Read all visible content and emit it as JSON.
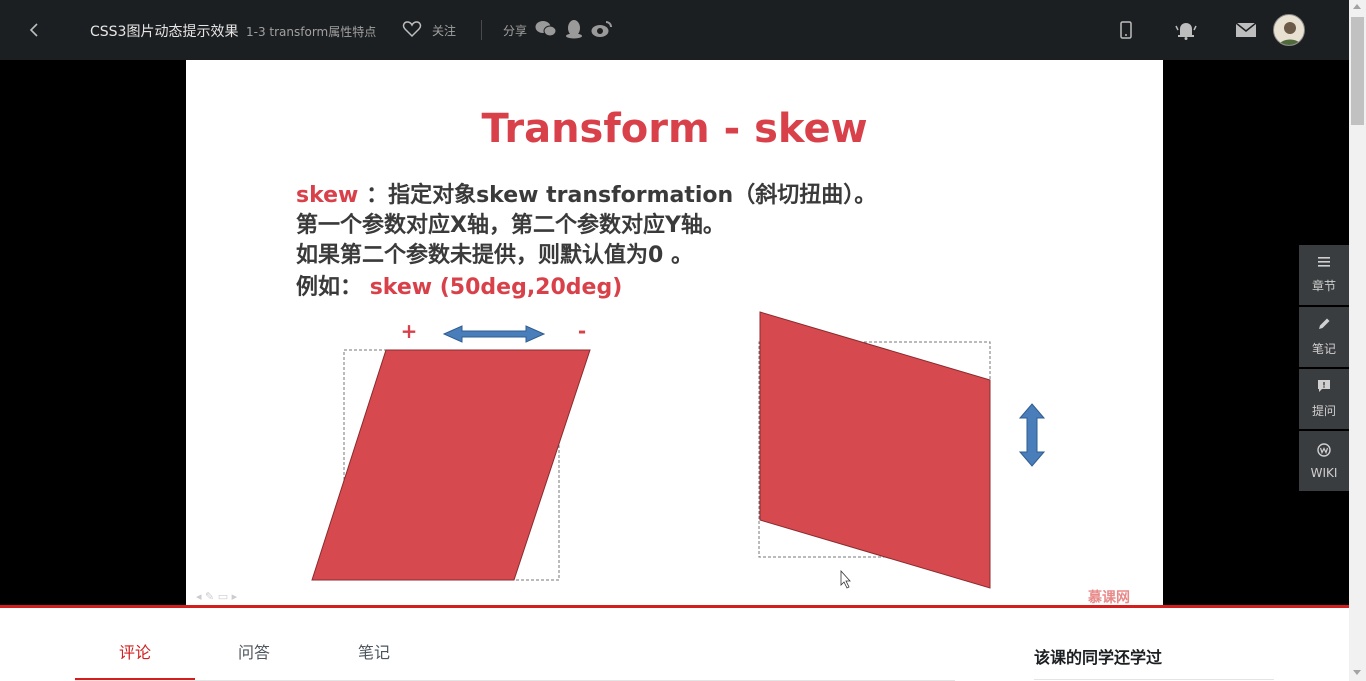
{
  "topbar": {
    "course_title": "CSS3图片动态提示效果",
    "chapter_title": "1-3 transform属性特点",
    "follow_label": "关注",
    "share_label": "分享",
    "icons": [
      "back-icon",
      "heart-icon",
      "wechat-icon",
      "qq-icon",
      "weibo-icon",
      "mobile-icon",
      "bell-icon",
      "mail-icon",
      "avatar"
    ]
  },
  "slide": {
    "title": "Transform - skew",
    "line1_keyword": "skew",
    "line1_text": "：指定对象skew transformation（斜切扭曲）。",
    "line2": "第一个参数对应X轴，第二个参数对应Y轴。",
    "line3": "如果第二个参数未提供，则默认值为0 。",
    "example_label": "例如：",
    "example_value": "skew (50deg,20deg)",
    "plus_sign": "+",
    "minus_sign": "-",
    "logo": "慕课网",
    "colors": {
      "accent": "#d9414a",
      "shape": "#d64a4f",
      "arrow": "#4a7ebb"
    }
  },
  "side_tools": [
    {
      "label": "章节",
      "icon": "menu-icon"
    },
    {
      "label": "笔记",
      "icon": "pencil-icon"
    },
    {
      "label": "提问",
      "icon": "question-icon"
    },
    {
      "label": "WIKI",
      "icon": "wiki-icon"
    }
  ],
  "bottom": {
    "tabs": [
      {
        "label": "评论",
        "active": true
      },
      {
        "label": "问答",
        "active": false
      },
      {
        "label": "笔记",
        "active": false
      }
    ],
    "related_title": "该课的同学还学过"
  }
}
